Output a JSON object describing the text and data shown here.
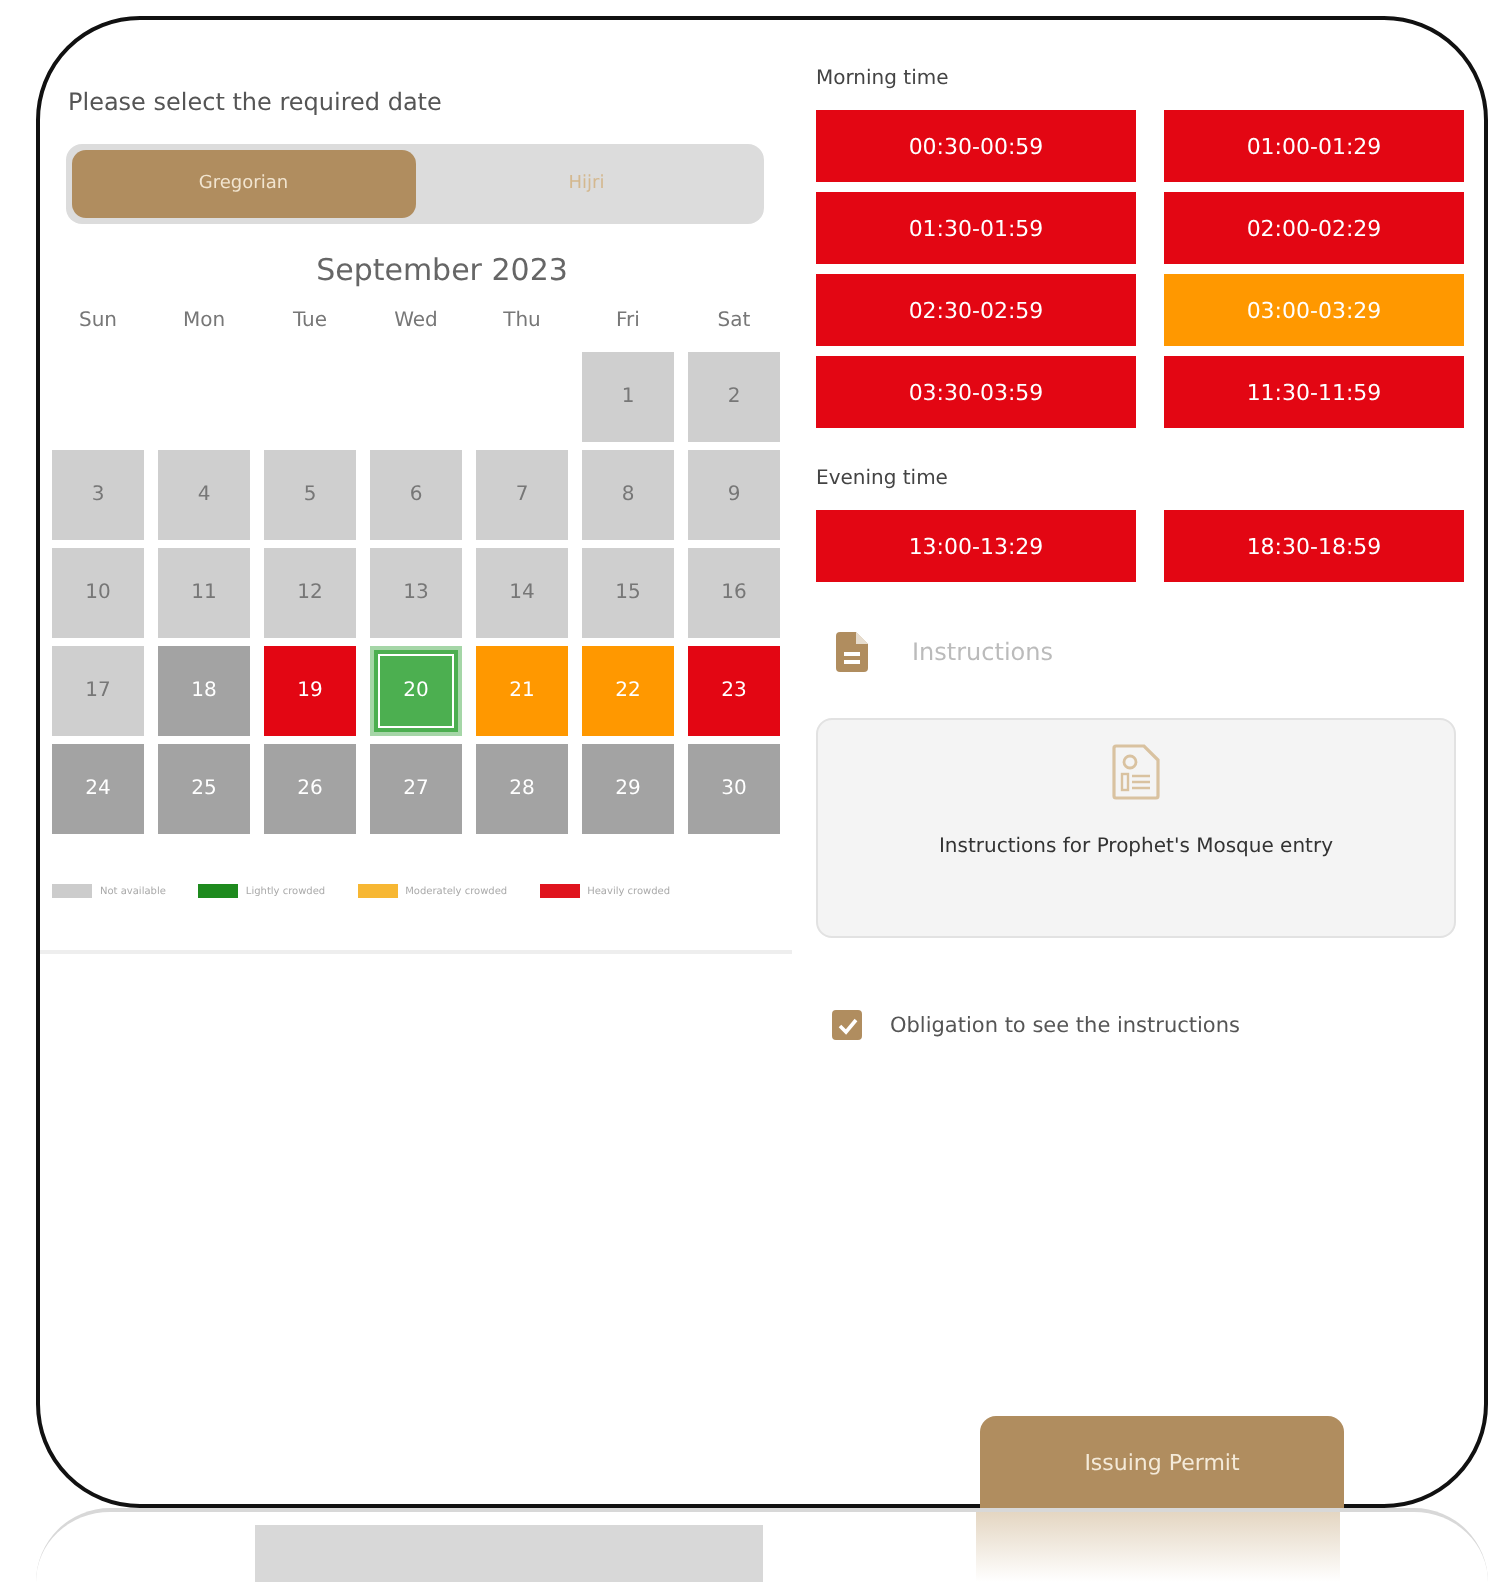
{
  "date_panel": {
    "title": "Please select the required date",
    "calendar_tabs": [
      {
        "label": "Gregorian",
        "selected": true
      },
      {
        "label": "Hijri",
        "selected": false
      }
    ],
    "month": "September 2023",
    "weekdays": [
      "Sun",
      "Mon",
      "Tue",
      "Wed",
      "Thu",
      "Fri",
      "Sat"
    ],
    "weeks": [
      [
        {
          "kind": "blank"
        },
        {
          "kind": "blank"
        },
        {
          "kind": "blank"
        },
        {
          "kind": "blank"
        },
        {
          "kind": "blank"
        },
        {
          "kind": "day",
          "day": "1",
          "color": "#cfcfcf",
          "selected": false
        },
        {
          "kind": "day",
          "day": "2",
          "color": "#cfcfcf",
          "selected": false
        }
      ],
      [
        {
          "kind": "day",
          "day": "3",
          "color": "#cfcfcf",
          "selected": false
        },
        {
          "kind": "day",
          "day": "4",
          "color": "#cfcfcf",
          "selected": false
        },
        {
          "kind": "day",
          "day": "5",
          "color": "#cfcfcf",
          "selected": false
        },
        {
          "kind": "day",
          "day": "6",
          "color": "#cfcfcf",
          "selected": false
        },
        {
          "kind": "day",
          "day": "7",
          "color": "#cfcfcf",
          "selected": false
        },
        {
          "kind": "day",
          "day": "8",
          "color": "#cfcfcf",
          "selected": false
        },
        {
          "kind": "day",
          "day": "9",
          "color": "#cfcfcf",
          "selected": false
        }
      ],
      [
        {
          "kind": "day",
          "day": "10",
          "color": "#cfcfcf",
          "selected": false
        },
        {
          "kind": "day",
          "day": "11",
          "color": "#cfcfcf",
          "selected": false
        },
        {
          "kind": "day",
          "day": "12",
          "color": "#cfcfcf",
          "selected": false
        },
        {
          "kind": "day",
          "day": "13",
          "color": "#cfcfcf",
          "selected": false
        },
        {
          "kind": "day",
          "day": "14",
          "color": "#cfcfcf",
          "selected": false
        },
        {
          "kind": "day",
          "day": "15",
          "color": "#cfcfcf",
          "selected": false
        },
        {
          "kind": "day",
          "day": "16",
          "color": "#cfcfcf",
          "selected": false
        }
      ],
      [
        {
          "kind": "day",
          "day": "17",
          "color": "#cfcfcf",
          "selected": false
        },
        {
          "kind": "day",
          "day": "18",
          "color": "#a3a3a3",
          "selected": false
        },
        {
          "kind": "day",
          "day": "19",
          "color": "#e30613",
          "selected": false
        },
        {
          "kind": "day",
          "day": "20",
          "color": "#4caf50",
          "selected": true
        },
        {
          "kind": "day",
          "day": "21",
          "color": "#ff9800",
          "selected": false
        },
        {
          "kind": "day",
          "day": "22",
          "color": "#ff9800",
          "selected": false
        },
        {
          "kind": "day",
          "day": "23",
          "color": "#e30613",
          "selected": false
        }
      ],
      [
        {
          "kind": "day",
          "day": "24",
          "color": "#a3a3a3",
          "selected": false
        },
        {
          "kind": "day",
          "day": "25",
          "color": "#a3a3a3",
          "selected": false
        },
        {
          "kind": "day",
          "day": "26",
          "color": "#a3a3a3",
          "selected": false
        },
        {
          "kind": "day",
          "day": "27",
          "color": "#a3a3a3",
          "selected": false
        },
        {
          "kind": "day",
          "day": "28",
          "color": "#a3a3a3",
          "selected": false
        },
        {
          "kind": "day",
          "day": "29",
          "color": "#a3a3a3",
          "selected": false
        },
        {
          "kind": "day",
          "day": "30",
          "color": "#a3a3a3",
          "selected": false
        }
      ]
    ],
    "legend": [
      {
        "label": "Not available",
        "color": "#cccccc"
      },
      {
        "label": "Lightly crowded",
        "color": "#1e8a1e"
      },
      {
        "label": "Moderately crowded",
        "color": "#f7b733"
      },
      {
        "label": "Heavily crowded",
        "color": "#e0141e"
      }
    ]
  },
  "time_panel": {
    "sections": [
      {
        "title": "Morning time",
        "slots": [
          {
            "label": "00:30-00:59",
            "color": "#e30613"
          },
          {
            "label": "01:00-01:29",
            "color": "#e30613"
          },
          {
            "label": "01:30-01:59",
            "color": "#e30613"
          },
          {
            "label": "02:00-02:29",
            "color": "#e30613"
          },
          {
            "label": "02:30-02:59",
            "color": "#e30613"
          },
          {
            "label": "03:00-03:29",
            "color": "#ff9800"
          },
          {
            "label": "03:30-03:59",
            "color": "#e30613"
          },
          {
            "label": "11:30-11:59",
            "color": "#e30613"
          }
        ]
      },
      {
        "title": "Evening time",
        "slots": [
          {
            "label": "13:00-13:29",
            "color": "#e30613"
          },
          {
            "label": "18:30-18:59",
            "color": "#e30613"
          }
        ]
      }
    ],
    "instructions": {
      "heading": "Instructions",
      "card_text": "Instructions for Prophet's Mosque entry"
    },
    "obligation": {
      "label": "Obligation to see the instructions",
      "checked": true
    }
  },
  "submit_button": "Issuing Permit"
}
